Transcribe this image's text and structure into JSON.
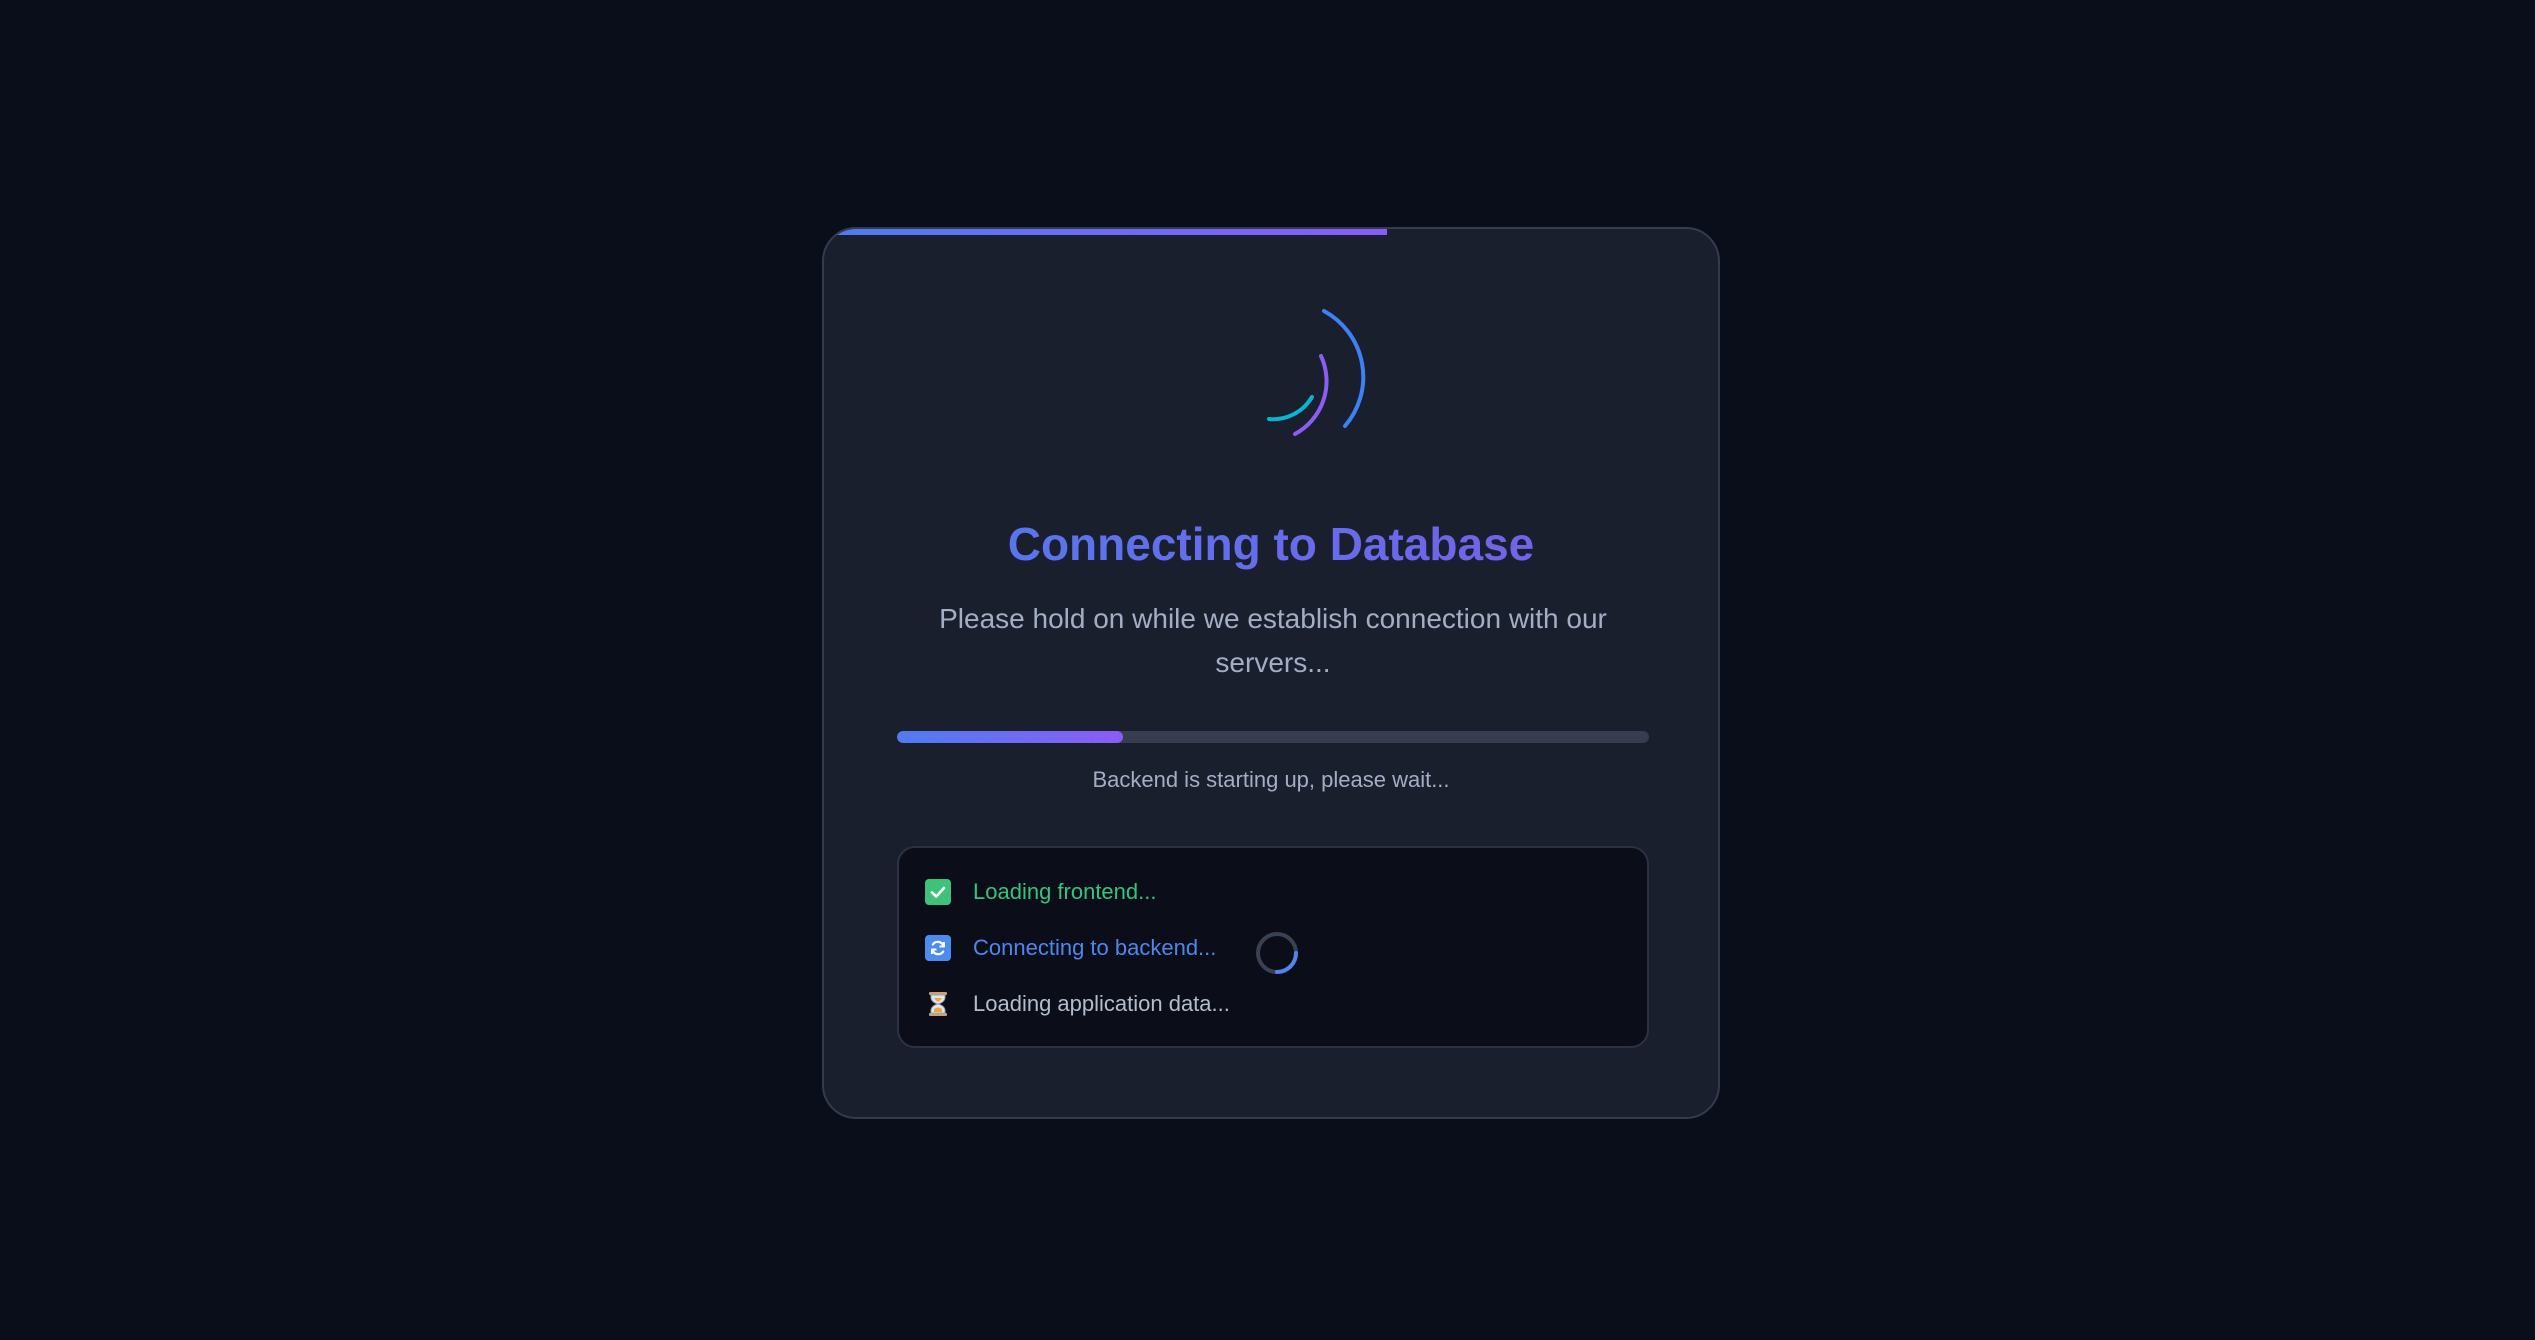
{
  "loader": {
    "title": "Connecting to Database",
    "subtitle": "Please hold on while we establish connection with our servers...",
    "top_progress_percent": 63,
    "progress_percent": 30,
    "status": "Backend is starting up, please wait..."
  },
  "steps": [
    {
      "label": "Loading frontend...",
      "state": "done",
      "icon": "check-box-icon"
    },
    {
      "label": "Connecting to backend...",
      "state": "active",
      "icon": "refresh-icon"
    },
    {
      "label": "Loading application data...",
      "state": "pending",
      "icon": "hourglass-icon"
    }
  ],
  "colors": {
    "background": "#0a0e1a",
    "card": "#1a1f2e",
    "accent_blue": "#4f7cf0",
    "accent_purple": "#8b5cf6",
    "accent_cyan": "#06b6d4",
    "success": "#35c37c"
  }
}
